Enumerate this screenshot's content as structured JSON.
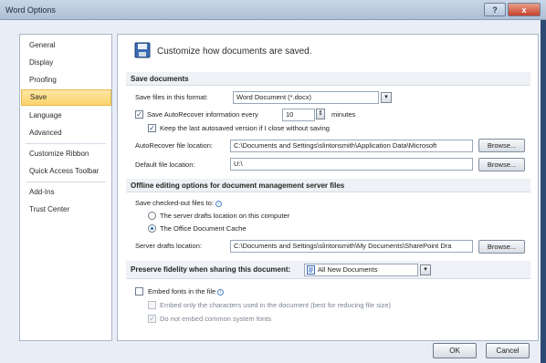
{
  "window": {
    "title": "Word Options",
    "help_label": "?",
    "close_label": "x"
  },
  "sidebar": {
    "items": [
      {
        "label": "General"
      },
      {
        "label": "Display"
      },
      {
        "label": "Proofing"
      },
      {
        "label": "Save"
      },
      {
        "label": "Language"
      },
      {
        "label": "Advanced"
      },
      {
        "label": "Customize Ribbon"
      },
      {
        "label": "Quick Access Toolbar"
      },
      {
        "label": "Add-Ins"
      },
      {
        "label": "Trust Center"
      }
    ],
    "active_index": 3
  },
  "header": {
    "text": "Customize how documents are saved."
  },
  "save_documents": {
    "section_title": "Save documents",
    "format_label": "Save files in this format:",
    "format_value": "Word Document (*.docx)",
    "autorecover_label": "Save AutoRecover information every",
    "autorecover_minutes": "10",
    "minutes_label": "minutes",
    "keep_last_label": "Keep the last autosaved version if I close without saving",
    "autorecover_location_label": "AutoRecover file location:",
    "autorecover_location_value": "C:\\Documents and Settings\\slintonsmith\\Application Data\\Microsoft",
    "default_location_label": "Default file location:",
    "default_location_value": "U:\\",
    "browse_label": "Browse..."
  },
  "offline": {
    "section_title": "Offline editing options for document management server files",
    "checked_out_label": "Save checked-out files to:",
    "option_server": "The server drafts location on this computer",
    "option_cache": "The Office Document Cache",
    "drafts_location_label": "Server drafts location:",
    "drafts_location_value": "C:\\Documents and Settings\\slintonsmith\\My Documents\\SharePoint Dra",
    "browse_label": "Browse..."
  },
  "fidelity": {
    "section_label": "Preserve fidelity when sharing this document:",
    "document_value": "All New Documents",
    "embed_fonts_label": "Embed fonts in the file",
    "embed_chars_label": "Embed only the characters used in the document (best for reducing file size)",
    "no_common_label": "Do not embed common system fonts"
  },
  "footer": {
    "ok_label": "OK",
    "cancel_label": "Cancel"
  },
  "colors": {
    "active_nav": "#fcd36b",
    "accent": "#2c5fbd",
    "window_bg": "#e9eef6"
  }
}
